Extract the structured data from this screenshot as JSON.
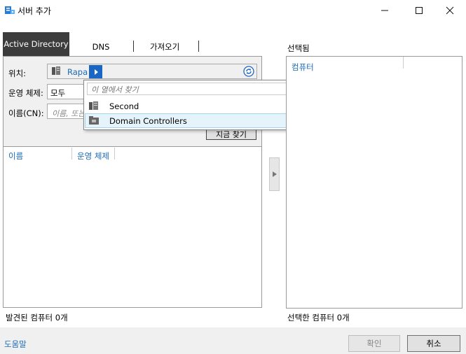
{
  "window": {
    "title": "서버 추가",
    "icon": "server-manager-icon"
  },
  "tabs": [
    {
      "label": "Active Directory",
      "active": true
    },
    {
      "label": "DNS"
    },
    {
      "label": "가져오기"
    }
  ],
  "search": {
    "location_label": "위치:",
    "location_value": "Rapa",
    "os_label": "운영 체제:",
    "os_value": "모두",
    "name_label": "이름(CN):",
    "name_placeholder": "이름, 또는",
    "find_button": "지금 찾기"
  },
  "popup": {
    "search_placeholder": "이 열에서 찾기",
    "items": [
      {
        "label": "Second",
        "icon": "domain-icon"
      },
      {
        "label": "Domain Controllers",
        "icon": "ou-folder-icon",
        "highlighted": true
      }
    ]
  },
  "results": {
    "columns": [
      "이름",
      "운영 체제"
    ],
    "count_text": "발견된 컴퓨터 0개"
  },
  "selected": {
    "title": "선택됨",
    "column": "컴퓨터",
    "count_text": "선택한 컴퓨터 0개"
  },
  "footer": {
    "help": "도움말",
    "ok": "확인",
    "cancel": "취소"
  },
  "colors": {
    "accent_blue": "#1a6bb5",
    "tab_active_bg": "#3c3c3c",
    "popup_highlight": "#e5f3fb"
  }
}
